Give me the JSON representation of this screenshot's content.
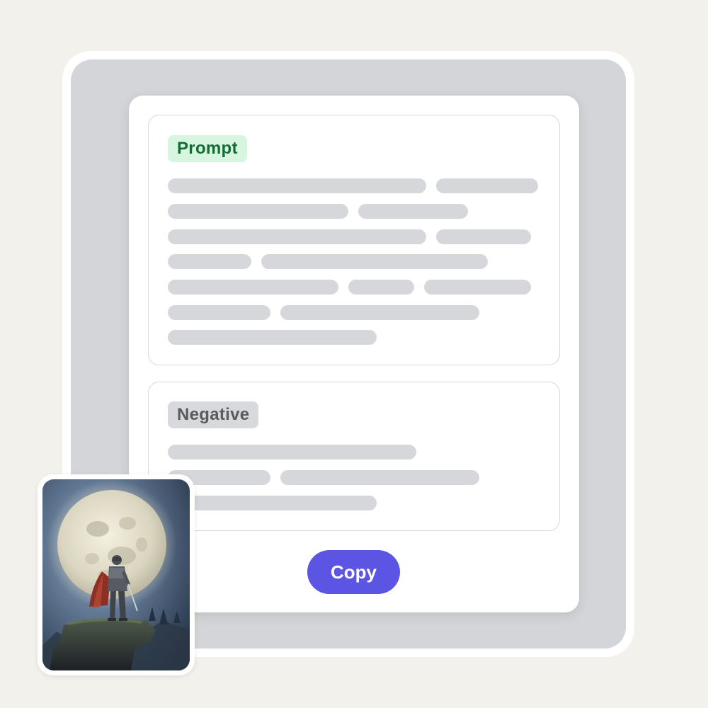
{
  "prompt_panel": {
    "tag_label": "Prompt"
  },
  "negative_panel": {
    "tag_label": "Negative"
  },
  "actions": {
    "copy_label": "Copy"
  },
  "image": {
    "subject": "knight-under-full-moon"
  },
  "colors": {
    "accent": "#5c55e3",
    "prompt_tag_bg": "#d7f5df",
    "prompt_tag_text": "#146b34",
    "negative_tag_bg": "#d8d9dc",
    "negative_tag_text": "#5a5b5f",
    "placeholder_line": "#d6d7da"
  }
}
